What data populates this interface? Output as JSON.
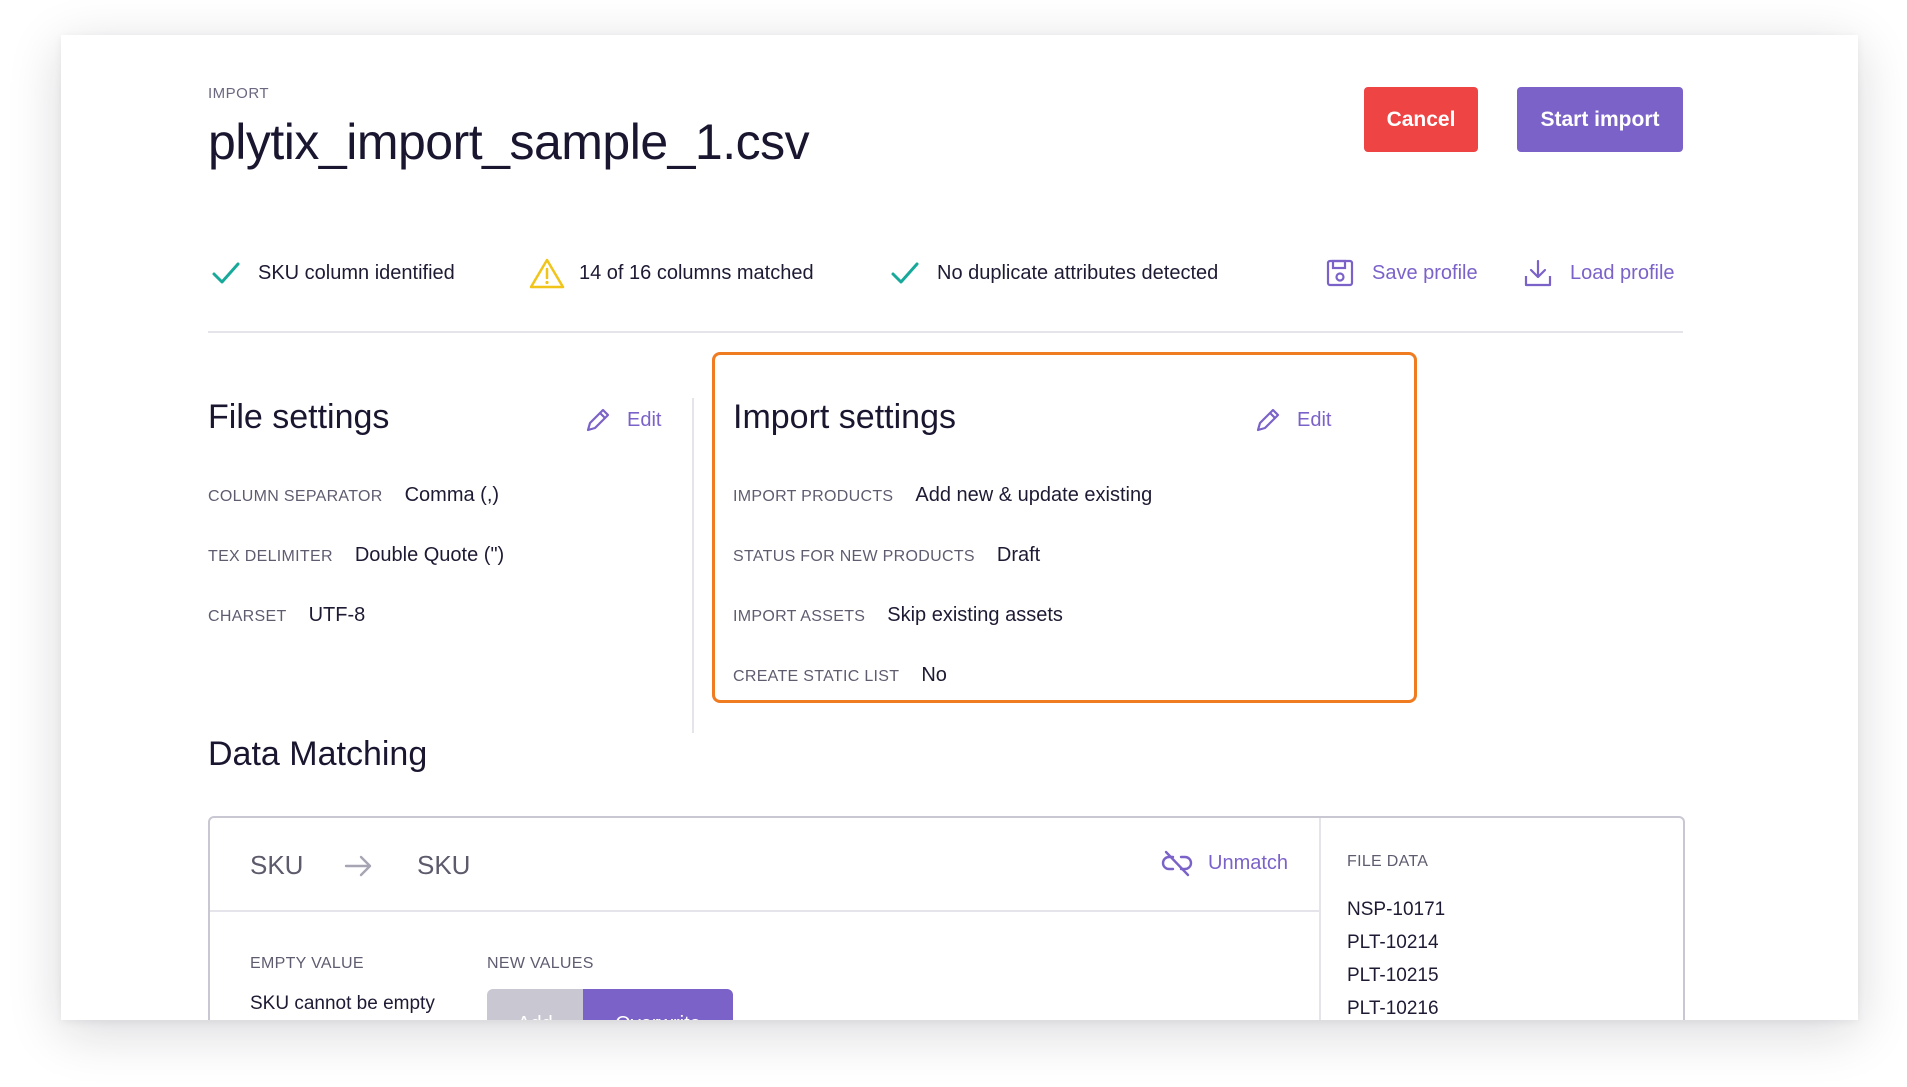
{
  "header": {
    "eyebrow": "IMPORT",
    "title": "plytix_import_sample_1.csv",
    "cancel_label": "Cancel",
    "start_label": "Start import"
  },
  "status_bar": {
    "sku": "SKU column identified",
    "columns": "14 of 16 columns matched",
    "duplicates": "No duplicate attributes detected",
    "save_profile": "Save profile",
    "load_profile": "Load profile"
  },
  "file_settings": {
    "heading": "File settings",
    "edit_label": "Edit",
    "rows": [
      {
        "key": "COLUMN SEPARATOR",
        "value": "Comma (,)"
      },
      {
        "key": "TEX DELIMITER",
        "value": "Double Quote (\")"
      },
      {
        "key": "CHARSET",
        "value": "UTF-8"
      }
    ]
  },
  "import_settings": {
    "heading": "Import settings",
    "edit_label": "Edit",
    "rows": [
      {
        "key": "IMPORT PRODUCTS",
        "value": "Add new & update existing"
      },
      {
        "key": "STATUS FOR NEW PRODUCTS",
        "value": "Draft"
      },
      {
        "key": "IMPORT ASSETS",
        "value": "Skip existing assets"
      },
      {
        "key": "CREATE STATIC LIST",
        "value": "No"
      }
    ]
  },
  "data_matching": {
    "heading": "Data Matching",
    "source": "SKU",
    "target": "SKU",
    "unmatch_label": "Unmatch",
    "empty_value_label": "EMPTY VALUE",
    "empty_value_text": "SKU cannot be empty",
    "new_values_label": "NEW VALUES",
    "add_label": "Add",
    "overwrite_label": "Overwrite",
    "file_data_label": "FILE DATA",
    "file_data": [
      "NSP-10171",
      "PLT-10214",
      "PLT-10215",
      "PLT-10216"
    ]
  },
  "colors": {
    "accent": "#7b62c9",
    "danger": "#ee4444",
    "success": "#17a99a",
    "warning": "#f0c419",
    "highlight": "#f07c22"
  }
}
